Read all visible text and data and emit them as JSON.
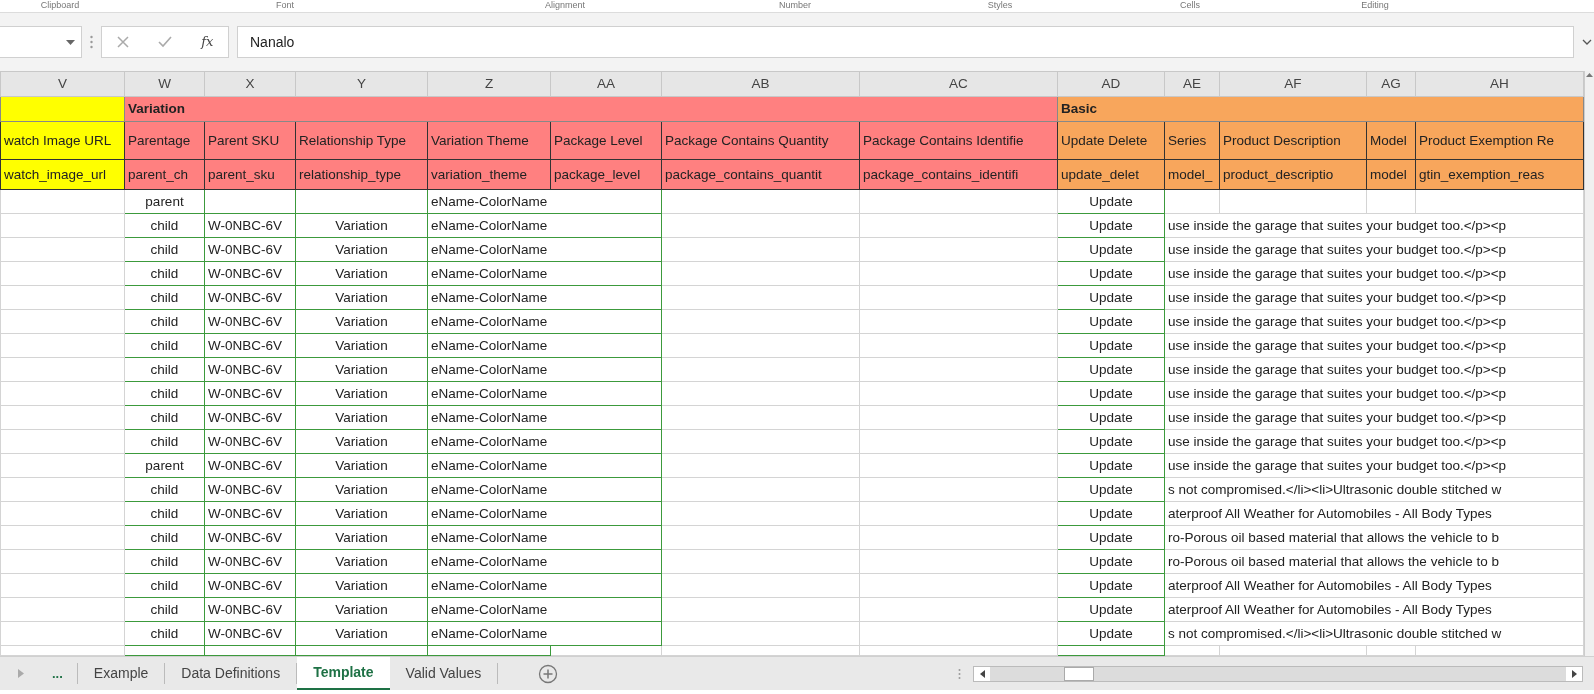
{
  "ribbon_groups": [
    "Clipboard",
    "Font",
    "Alignment",
    "Number",
    "Styles",
    "Cells",
    "Editing"
  ],
  "formula_bar": {
    "function_label": "fx",
    "value": "Nanalo"
  },
  "table": {
    "groups": [
      {
        "color": "#ffff00",
        "columns": [
          {
            "letter": "V",
            "label": "watch Image URL",
            "field": "watch_image_url"
          }
        ]
      },
      {
        "title": "Variation",
        "color": "#ff8080",
        "columns": [
          {
            "letter": "W",
            "label": "Parentage",
            "field": "parent_ch"
          },
          {
            "letter": "X",
            "label": "Parent SKU",
            "field": "parent_sku"
          },
          {
            "letter": "Y",
            "label": "Relationship Type",
            "field": "relationship_type"
          },
          {
            "letter": "Z",
            "label": "Variation Theme",
            "field": "variation_theme"
          },
          {
            "letter": "AA",
            "label": "Package Level",
            "field": "package_level"
          },
          {
            "letter": "AB",
            "label": "Package Contains Quantity",
            "field": "package_contains_quantit"
          },
          {
            "letter": "AC",
            "label": "Package Contains Identifie",
            "field": "package_contains_identifi"
          }
        ]
      },
      {
        "title": "Basic",
        "color": "#f8a65c",
        "columns": [
          {
            "letter": "AD",
            "label": "Update Delete",
            "field": "update_delet"
          },
          {
            "letter": "AE",
            "label": "Series",
            "field": "model_"
          },
          {
            "letter": "AF",
            "label": "Product Description",
            "field": "product_descriptio"
          },
          {
            "letter": "AG",
            "label": "Model",
            "field": "model"
          },
          {
            "letter": "AH",
            "label": "Product Exemption Re",
            "field": "gtin_exemption_reas"
          }
        ]
      }
    ],
    "rows": [
      {
        "parentage": "parent",
        "variation_theme": "eName-ColorName",
        "update_delete": "Update"
      },
      {
        "parentage": "child",
        "parent_sku": "W-0NBC-6V",
        "relationship_type": "Variation",
        "variation_theme": "eName-ColorName",
        "update_delete": "Update",
        "description": "use inside the garage that suites your budget too.</p><p"
      },
      {
        "parentage": "child",
        "parent_sku": "W-0NBC-6V",
        "relationship_type": "Variation",
        "variation_theme": "eName-ColorName",
        "update_delete": "Update",
        "description": "use inside the garage that suites your budget too.</p><p"
      },
      {
        "parentage": "child",
        "parent_sku": "W-0NBC-6V",
        "relationship_type": "Variation",
        "variation_theme": "eName-ColorName",
        "update_delete": "Update",
        "description": "use inside the garage that suites your budget too.</p><p"
      },
      {
        "parentage": "child",
        "parent_sku": "W-0NBC-6V",
        "relationship_type": "Variation",
        "variation_theme": "eName-ColorName",
        "update_delete": "Update",
        "description": "use inside the garage that suites your budget too.</p><p"
      },
      {
        "parentage": "child",
        "parent_sku": "W-0NBC-6V",
        "relationship_type": "Variation",
        "variation_theme": "eName-ColorName",
        "update_delete": "Update",
        "description": "use inside the garage that suites your budget too.</p><p"
      },
      {
        "parentage": "child",
        "parent_sku": "W-0NBC-6V",
        "relationship_type": "Variation",
        "variation_theme": "eName-ColorName",
        "update_delete": "Update",
        "description": "use inside the garage that suites your budget too.</p><p"
      },
      {
        "parentage": "child",
        "parent_sku": "W-0NBC-6V",
        "relationship_type": "Variation",
        "variation_theme": "eName-ColorName",
        "update_delete": "Update",
        "description": "use inside the garage that suites your budget too.</p><p"
      },
      {
        "parentage": "child",
        "parent_sku": "W-0NBC-6V",
        "relationship_type": "Variation",
        "variation_theme": "eName-ColorName",
        "update_delete": "Update",
        "description": "use inside the garage that suites your budget too.</p><p"
      },
      {
        "parentage": "child",
        "parent_sku": "W-0NBC-6V",
        "relationship_type": "Variation",
        "variation_theme": "eName-ColorName",
        "update_delete": "Update",
        "description": "use inside the garage that suites your budget too.</p><p"
      },
      {
        "parentage": "child",
        "parent_sku": "W-0NBC-6V",
        "relationship_type": "Variation",
        "variation_theme": "eName-ColorName",
        "update_delete": "Update",
        "description": "use inside the garage that suites your budget too.</p><p"
      },
      {
        "parentage": "parent",
        "parent_sku": "W-0NBC-6V",
        "relationship_type": "Variation",
        "variation_theme": "eName-ColorName",
        "update_delete": "Update",
        "description": "use inside the garage that suites your budget too.</p><p"
      },
      {
        "parentage": "child",
        "parent_sku": "W-0NBC-6V",
        "relationship_type": "Variation",
        "variation_theme": "eName-ColorName",
        "update_delete": "Update",
        "description": "s not compromised.</li><li>Ultrasonic double stitched w"
      },
      {
        "parentage": "child",
        "parent_sku": "W-0NBC-6V",
        "relationship_type": "Variation",
        "variation_theme": "eName-ColorName",
        "update_delete": "Update",
        "description": "aterproof All Weather for Automobiles - All Body Types"
      },
      {
        "parentage": "child",
        "parent_sku": "W-0NBC-6V",
        "relationship_type": "Variation",
        "variation_theme": "eName-ColorName",
        "update_delete": "Update",
        "description": "ro-Porous oil based material that allows the vehicle to b"
      },
      {
        "parentage": "child",
        "parent_sku": "W-0NBC-6V",
        "relationship_type": "Variation",
        "variation_theme": "eName-ColorName",
        "update_delete": "Update",
        "description": "ro-Porous oil based material that allows the vehicle to b"
      },
      {
        "parentage": "child",
        "parent_sku": "W-0NBC-6V",
        "relationship_type": "Variation",
        "variation_theme": "eName-ColorName",
        "update_delete": "Update",
        "description": "aterproof All Weather for Automobiles - All Body Types"
      },
      {
        "parentage": "child",
        "parent_sku": "W-0NBC-6V",
        "relationship_type": "Variation",
        "variation_theme": "eName-ColorName",
        "update_delete": "Update",
        "description": "aterproof All Weather for Automobiles - All Body Types"
      },
      {
        "parentage": "child",
        "parent_sku": "W-0NBC-6V",
        "relationship_type": "Variation",
        "variation_theme": "eName-ColorName",
        "update_delete": "Update",
        "description": "s not compromised.</li><li>Ultrasonic double stitched w"
      }
    ]
  },
  "sheet_tabs": {
    "overflow_label": "...",
    "tabs": [
      {
        "label": "Example",
        "selected": false
      },
      {
        "label": "Data Definitions",
        "selected": false
      },
      {
        "label": "Template",
        "selected": true
      },
      {
        "label": "Valid Values",
        "selected": false
      }
    ]
  }
}
